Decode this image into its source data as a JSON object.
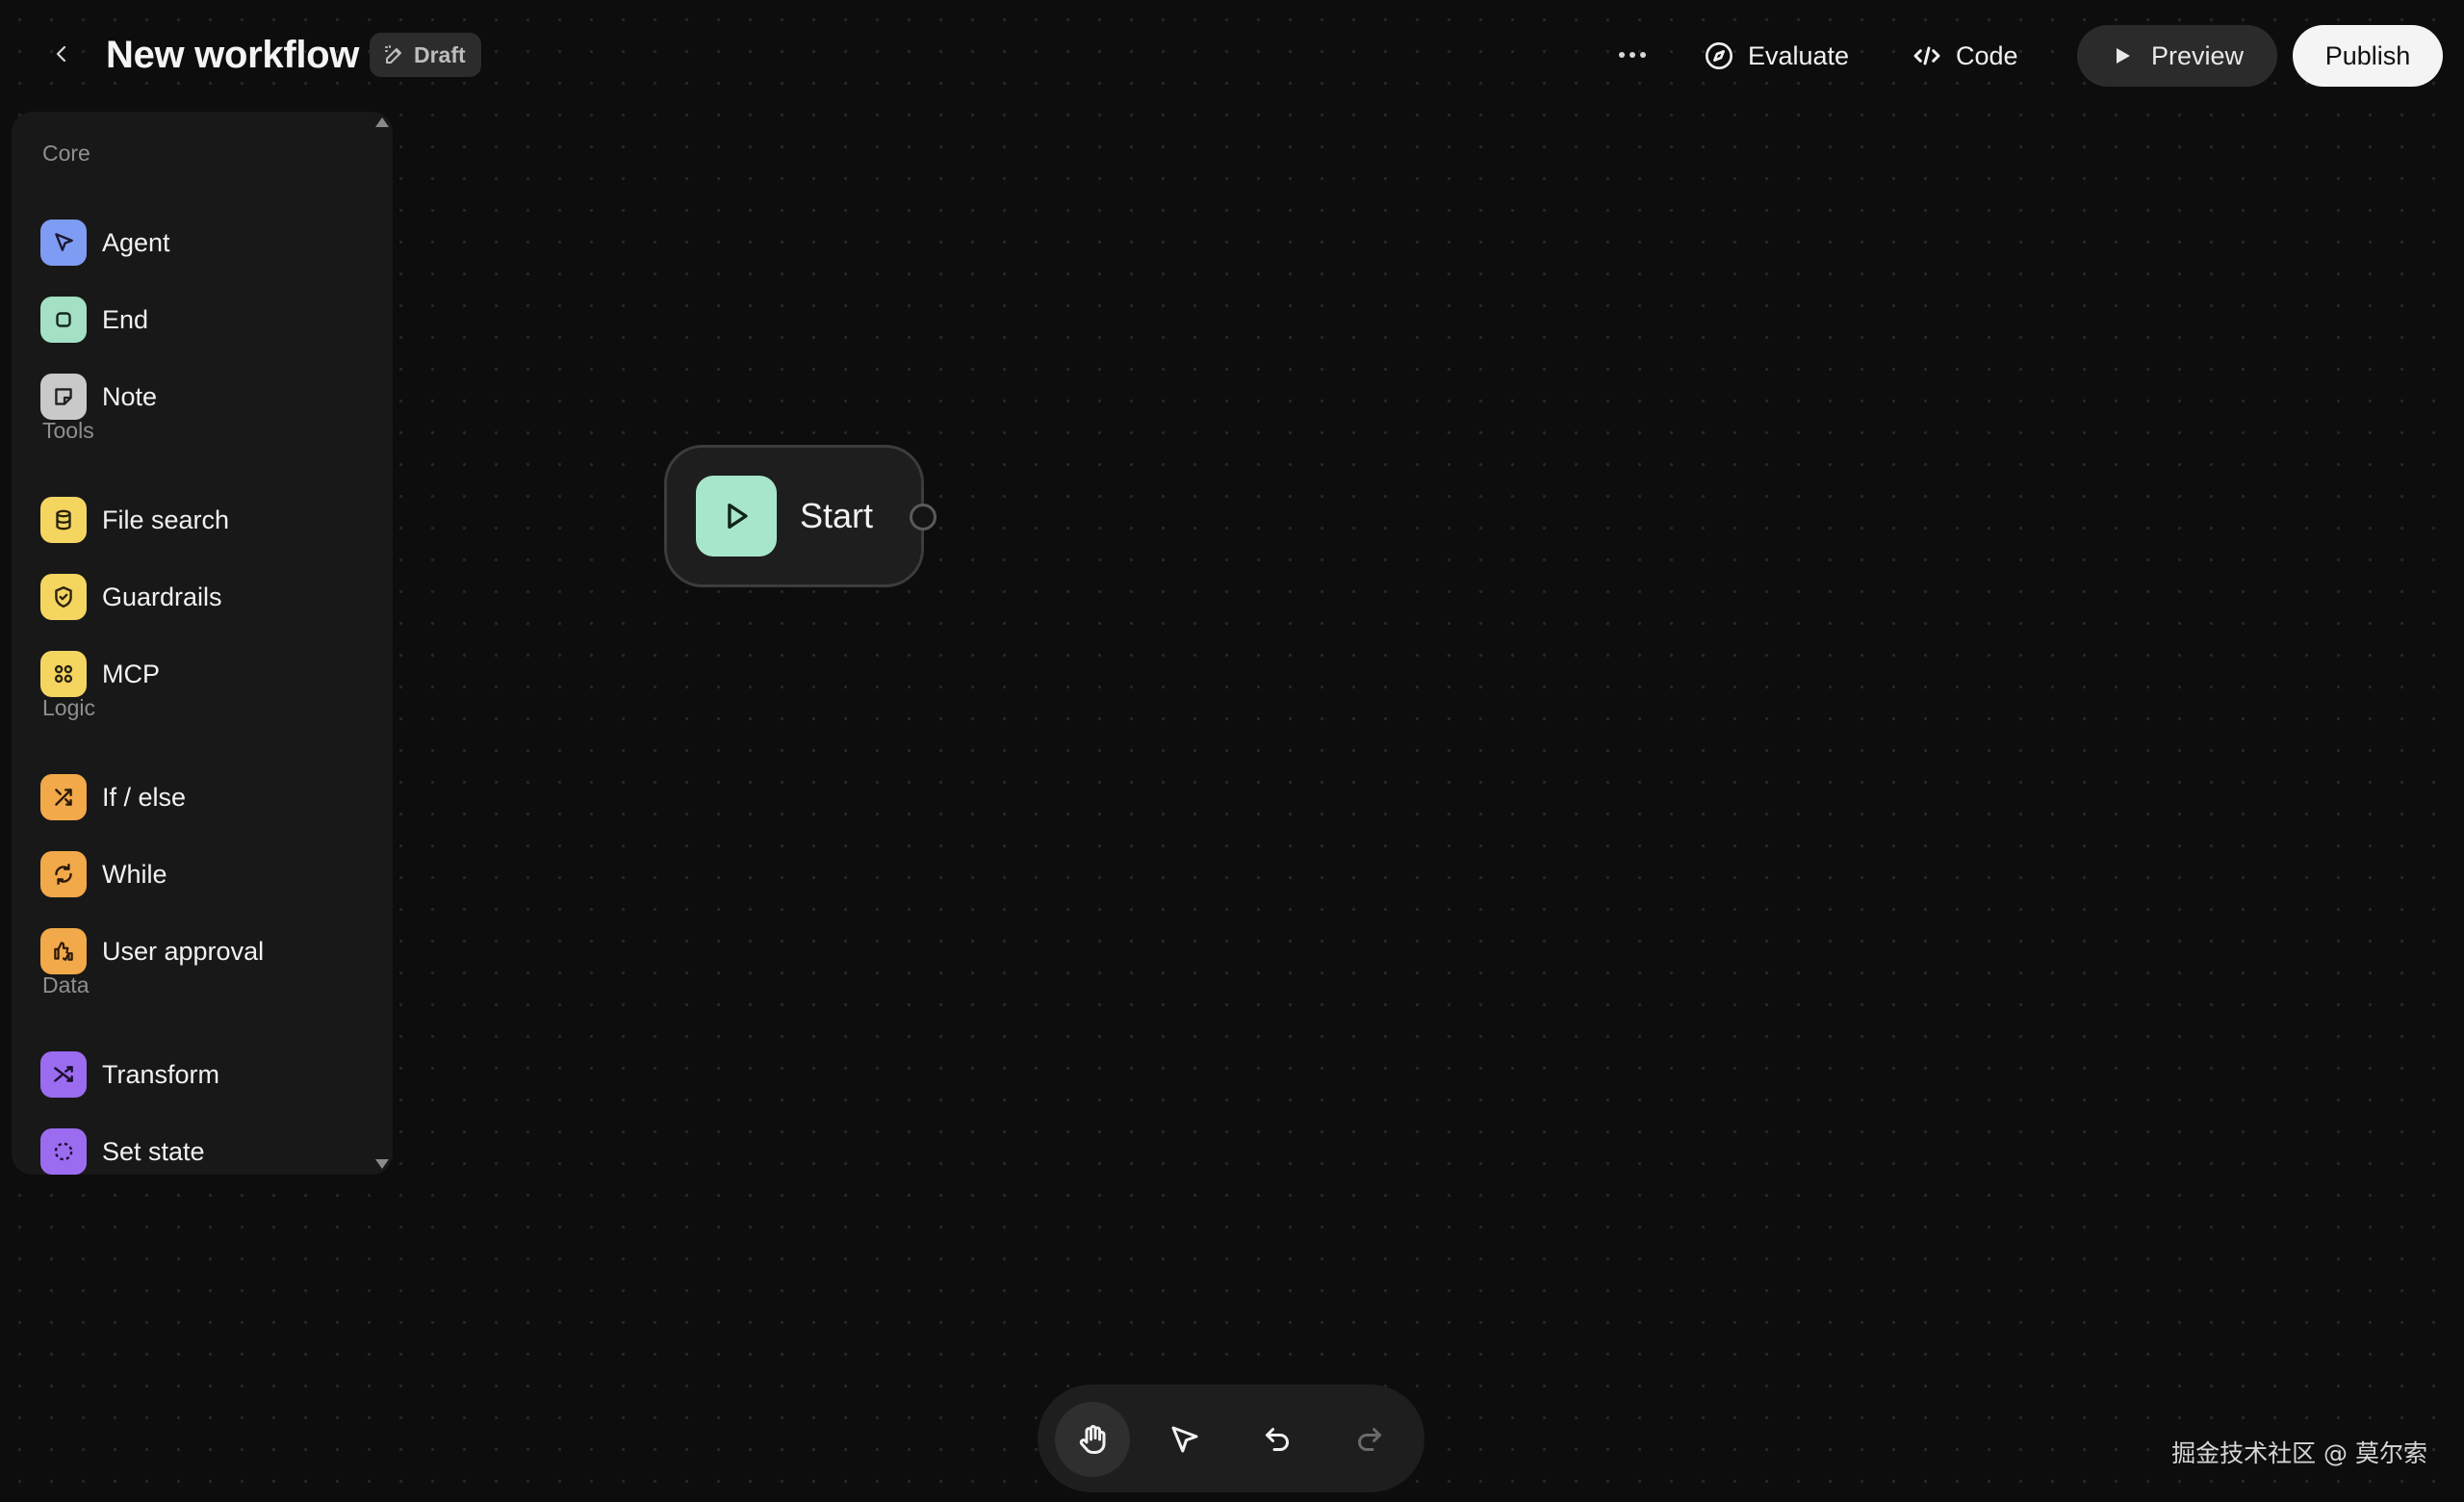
{
  "header": {
    "title": "New workflow",
    "status_badge": "Draft",
    "actions": {
      "evaluate": "Evaluate",
      "code": "Code",
      "preview": "Preview",
      "publish": "Publish"
    },
    "icons": {
      "back": "chevron-left-icon",
      "draft": "edit-icon",
      "more": "ellipsis-icon",
      "evaluate": "compass-icon",
      "code": "code-icon",
      "preview": "play-icon"
    }
  },
  "sidebar": {
    "sections": [
      {
        "label": "Core",
        "items": [
          {
            "label": "Agent",
            "icon": "cursor-icon",
            "color": "#7e9cf3"
          },
          {
            "label": "End",
            "icon": "stop-icon",
            "color": "#a3e0c4"
          },
          {
            "label": "Note",
            "icon": "note-icon",
            "color": "#c9c9c9"
          }
        ]
      },
      {
        "label": "Tools",
        "items": [
          {
            "label": "File search",
            "icon": "database-icon",
            "color": "#f4d560"
          },
          {
            "label": "Guardrails",
            "icon": "shield-icon",
            "color": "#f4d560"
          },
          {
            "label": "MCP",
            "icon": "command-icon",
            "color": "#f4d560"
          }
        ]
      },
      {
        "label": "Logic",
        "items": [
          {
            "label": "If / else",
            "icon": "branch-icon",
            "color": "#f2a94a"
          },
          {
            "label": "While",
            "icon": "loop-icon",
            "color": "#f2a94a"
          },
          {
            "label": "User approval",
            "icon": "thumbs-icon",
            "color": "#f2a94a"
          }
        ]
      },
      {
        "label": "Data",
        "items": [
          {
            "label": "Transform",
            "icon": "shuffle-icon",
            "color": "#9b6cf0"
          },
          {
            "label": "Set state",
            "icon": "dashed-circle-icon",
            "color": "#9b6cf0"
          }
        ]
      }
    ]
  },
  "canvas": {
    "start_node": {
      "label": "Start",
      "icon": "play-icon",
      "color": "#a8e6cc"
    }
  },
  "toolbar": {
    "tools": [
      "hand-icon",
      "pointer-icon",
      "undo-icon",
      "redo-icon"
    ],
    "active_tool": "hand-icon"
  },
  "watermark": "掘金技术社区 @ 莫尔索"
}
